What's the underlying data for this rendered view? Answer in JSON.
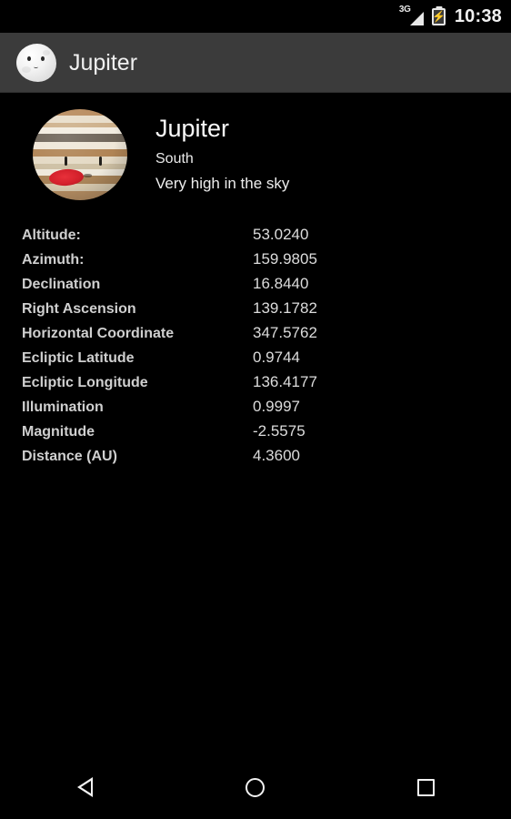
{
  "status_bar": {
    "network_label": "3G",
    "signal_icon": "signal-triangle-icon",
    "battery_icon": "battery-charging-icon",
    "battery_glyph": "⚡",
    "clock": "10:38"
  },
  "action_bar": {
    "app_icon": "moon-face-icon",
    "title": "Jupiter"
  },
  "object": {
    "image_icon": "jupiter-planet-icon",
    "name": "Jupiter",
    "direction": "South",
    "visibility": "Very high in the sky"
  },
  "data_rows": [
    {
      "label": "Altitude:",
      "value": "53.0240"
    },
    {
      "label": "Azimuth:",
      "value": "159.9805"
    },
    {
      "label": "Declination",
      "value": "16.8440"
    },
    {
      "label": "Right Ascension",
      "value": "139.1782"
    },
    {
      "label": "Horizontal Coordinate",
      "value": "347.5762"
    },
    {
      "label": "Ecliptic Latitude",
      "value": "0.9744"
    },
    {
      "label": "Ecliptic Longitude",
      "value": "136.4177"
    },
    {
      "label": "Illumination",
      "value": "0.9997"
    },
    {
      "label": "Magnitude",
      "value": "-2.5575"
    },
    {
      "label": "Distance (AU)",
      "value": "4.3600"
    }
  ],
  "nav_bar": {
    "back": "back-icon",
    "home": "home-icon",
    "recents": "recents-icon"
  },
  "colors": {
    "background": "#000000",
    "action_bar": "#3b3b3b",
    "label_text": "#cfcfcf",
    "value_text": "#dcdcdc",
    "title_text": "#fafafa"
  }
}
